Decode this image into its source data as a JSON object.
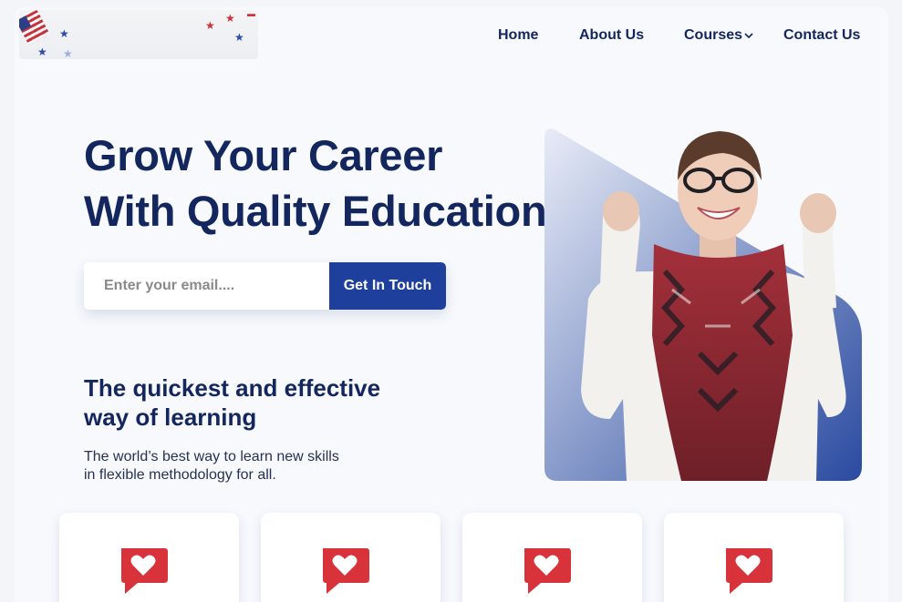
{
  "nav": {
    "items": [
      {
        "label": "Home"
      },
      {
        "label": "About Us"
      },
      {
        "label": "Courses"
      },
      {
        "label": "Contact Us"
      }
    ],
    "dropdown_icon": "chevron-down-icon"
  },
  "hero": {
    "title_line1": "Grow Your Career",
    "title_line2": "With Quality Education",
    "email_placeholder": "Enter your email....",
    "cta_label": "Get In Touch"
  },
  "section": {
    "title_line1": "The quickest and effective",
    "title_line2": "way of learning",
    "text_line1": "The world’s best way to learn new skills",
    "text_line2": "in flexible methodology for all."
  },
  "cards": [
    {
      "icon": "heart-chat-icon"
    },
    {
      "icon": "heart-chat-icon"
    },
    {
      "icon": "heart-chat-icon"
    },
    {
      "icon": "heart-chat-icon"
    }
  ],
  "colors": {
    "primary": "#13265e",
    "accent": "#1f3f9c",
    "icon_red": "#d8333b",
    "background": "#f7f9fd"
  }
}
